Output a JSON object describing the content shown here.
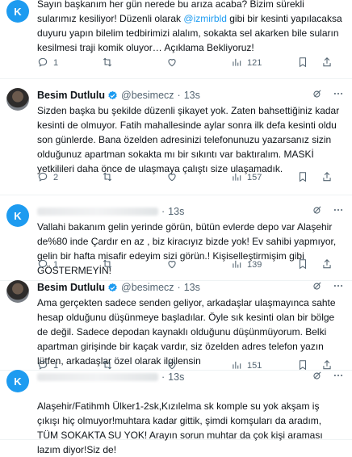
{
  "tweets": [
    {
      "author_kind": "anon",
      "avatar_letter": "K",
      "time": "13s",
      "paragraphs": [
        [
          {
            "t": "Sayın başkanım her gün nerede bu arıza acaba? Bizim sürekli sularımız kesiliyor! Düzenli olarak "
          },
          {
            "t": "@izmirbld",
            "m": true
          },
          {
            "t": " gibi bir kesinti yapılacaksa duyuru yapın bilelim tedbirimizi alalım, sokakta sel akarken bile suların kesilmesi traji komik oluyor… Açıklama Bekliyoruz!"
          }
        ]
      ],
      "stats": {
        "replies": "1",
        "retweets": "",
        "likes": "",
        "views": "121"
      }
    },
    {
      "author_kind": "user",
      "name": "Besim Dutlulu",
      "handle": "@besimecz",
      "time": "13s",
      "paragraphs": [
        [
          {
            "t": "Sizden başka bu şekilde düzenli şikayet yok. Zaten bahsettiğiniz kadar kesinti de olmuyor. Fatih mahallesinde aylar sonra ilk defa kesinti oldu son günlerde. Bana özelden adresinizi telefonunuzu yazarsanız sizin olduğunuz apartman sokakta mı bir sıkıntı var baktıralım. MASKİ yetkilileri daha önce de ulaşmaya çalıştı size ulaşamadık."
          }
        ]
      ],
      "stats": {
        "replies": "2",
        "retweets": "",
        "likes": "",
        "views": "157"
      }
    },
    {
      "author_kind": "anon",
      "avatar_letter": "K",
      "time": "13s",
      "paragraphs": [
        [
          {
            "t": "Vallahi bakanım gelin yerinde görün, bütün evlerde depo var Alaşehir de%80 inde Çardır en az , biz kiracıyız bizde yok! Ev sahibi yapmıyor, gelin bir hafta misafir edeyim sizi görün.! Kişiselleştirmişim gibi GÖSTERMEYİN!"
          }
        ]
      ],
      "stats": {
        "replies": "1",
        "retweets": "",
        "likes": "",
        "views": "139"
      }
    },
    {
      "author_kind": "user",
      "name": "Besim Dutlulu",
      "handle": "@besimecz",
      "time": "13s",
      "paragraphs": [
        [
          {
            "t": "Ama gerçekten sadece senden geliyor, arkadaşlar ulaşmayınca sahte hesap olduğunu düşünmeye başladılar. Öyle sık kesinti olan bir bölge de değil. Sadece depodan kaynaklı olduğunu düşünmüyorum. Belki apartman girişinde bir kaçak vardır, siz özelden adres telefon yazın lütfen, arkadaşlar özel olarak ilgilensin"
          }
        ]
      ],
      "stats": {
        "replies": "1",
        "retweets": "",
        "likes": "",
        "views": "151"
      }
    },
    {
      "author_kind": "anon",
      "avatar_letter": "K",
      "time": "13s",
      "paragraphs": [
        [
          {
            "t": "Alaşehir/Fatihmh Ülker1-2sk,Kızılelma sk komple su yok akşam iş çıkışı hiç olmuyor!muhtara kadar gittik, şimdi komşuları da aradım, TÜM SOKAKTA SU YOK! Arayın sorun muhtar da çok kişi araması lazım diyor!Siz de!"
          }
        ]
      ],
      "stats": null
    }
  ],
  "colors": {
    "accent": "#1d9bf0",
    "text": "#0f1419",
    "muted": "#536471",
    "divider": "#eff3f4"
  },
  "icons": [
    "reply-icon",
    "retweet-icon",
    "like-icon",
    "views-icon",
    "bookmark-icon",
    "share-icon",
    "grok-icon",
    "more-icon",
    "verified-badge-icon"
  ]
}
